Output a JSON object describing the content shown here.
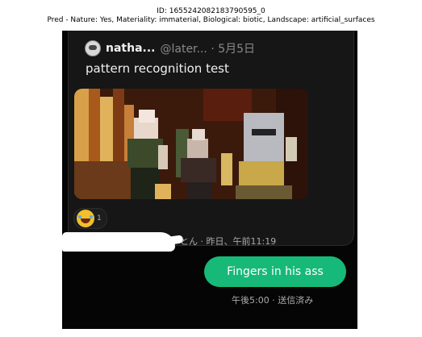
{
  "caption": {
    "id_line": "ID: 1655242082183790595_0",
    "pred_line": "Pred - Nature: Yes, Materiality: immaterial, Biological: biotic, Landscape: artificial_surfaces"
  },
  "quote": {
    "author_name": "natha...",
    "handle_and_date": "@later... · 5月5日",
    "text": "pattern recognition test"
  },
  "reaction": {
    "emoji": "face-with-tears-of-joy-icon",
    "count": "1"
  },
  "received_meta": "とん · 昨日、午前11:19",
  "sent_message": {
    "text": "Fingers in his ass",
    "bubble_color": "#17b978"
  },
  "sent_meta": "午後5:00 · 送信済み",
  "colors": {
    "background": "#050505",
    "card": "#161616",
    "muted_text": "#aaaaaa"
  }
}
